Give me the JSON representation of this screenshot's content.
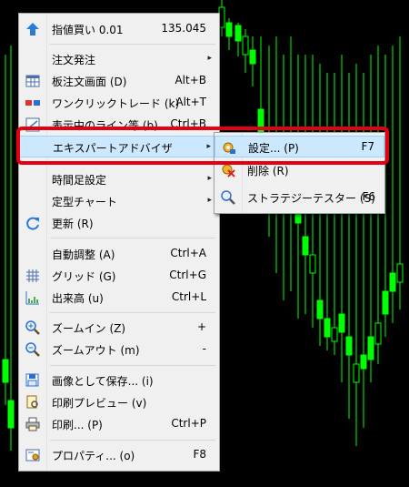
{
  "context_menu": {
    "items": [
      {
        "label": "指値買い 0.01",
        "shortcut": "135.045",
        "icon": "buy-limit-icon"
      },
      {
        "label": "注文発注",
        "submenu": true
      },
      {
        "label": "板注文画面 (D)",
        "shortcut": "Alt+B",
        "icon": "depth-of-market-icon"
      },
      {
        "label": "ワンクリックトレード (k)",
        "shortcut": "Alt+T",
        "icon": "one-click-trading-icon"
      },
      {
        "label": "表示中のライン等 (b)",
        "shortcut": "Ctrl+B",
        "icon": "objects-list-icon"
      },
      {
        "label": "エキスパートアドバイザ",
        "submenu": true
      },
      {
        "label": "時間足設定",
        "submenu": true
      },
      {
        "label": "定型チャート",
        "submenu": true
      },
      {
        "label": "更新 (R)",
        "icon": "refresh-icon"
      },
      {
        "label": "自動調整 (A)",
        "shortcut": "Ctrl+A"
      },
      {
        "label": "グリッド (G)",
        "shortcut": "Ctrl+G",
        "icon": "grid-icon"
      },
      {
        "label": "出来高 (u)",
        "shortcut": "Ctrl+L",
        "icon": "volumes-icon"
      },
      {
        "label": "ズームイン (Z)",
        "shortcut": "+",
        "icon": "zoom-in-icon"
      },
      {
        "label": "ズームアウト (m)",
        "shortcut": "-",
        "icon": "zoom-out-icon"
      },
      {
        "label": "画像として保存... (i)",
        "icon": "save-picture-icon"
      },
      {
        "label": "印刷プレビュー (v)",
        "icon": "print-preview-icon"
      },
      {
        "label": "印刷... (P)",
        "shortcut": "Ctrl+P",
        "icon": "print-icon"
      },
      {
        "label": "プロパティ... (o)",
        "shortcut": "F8",
        "icon": "properties-icon"
      }
    ]
  },
  "expert_submenu": {
    "items": [
      {
        "label": "設定... (P)",
        "shortcut": "F7",
        "icon": "settings-icon"
      },
      {
        "label": "削除 (R)",
        "icon": "remove-icon"
      },
      {
        "label": "ストラテジーテスター (S)",
        "shortcut": "F6",
        "icon": "strategy-tester-icon"
      }
    ]
  },
  "submenu_arrow": "▸",
  "colors": {
    "chart_background": "#000000",
    "candle_color": "#00ff00",
    "highlight": "#cce8ff",
    "annotation_box": "#e3000f"
  }
}
